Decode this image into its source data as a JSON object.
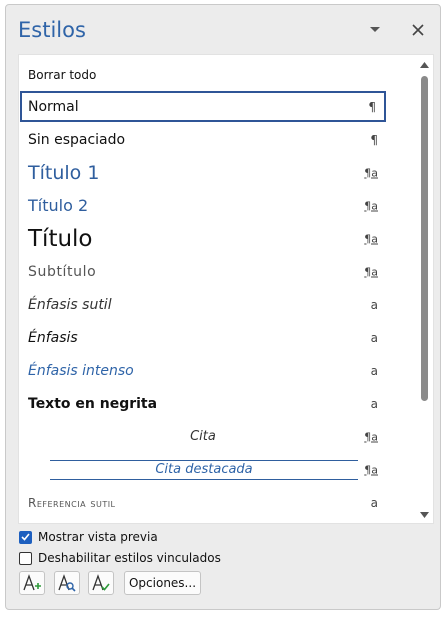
{
  "pane": {
    "title": "Estilos",
    "accent_color": "#2f64a8"
  },
  "styles": [
    {
      "label": "Borrar todo",
      "mark": "",
      "kind": "clear"
    },
    {
      "label": "Normal",
      "mark": "¶",
      "kind": "paragraph",
      "selected": true
    },
    {
      "label": "Sin espaciado",
      "mark": "¶",
      "kind": "paragraph"
    },
    {
      "label": "Título 1",
      "mark": "¶a",
      "kind": "linked"
    },
    {
      "label": "Título 2",
      "mark": "¶a",
      "kind": "linked"
    },
    {
      "label": "Título",
      "mark": "¶a",
      "kind": "linked"
    },
    {
      "label": "Subtítulo",
      "mark": "¶a",
      "kind": "linked"
    },
    {
      "label": "Énfasis sutil",
      "mark": "a",
      "kind": "character"
    },
    {
      "label": "Énfasis",
      "mark": "a",
      "kind": "character"
    },
    {
      "label": "Énfasis intenso",
      "mark": "a",
      "kind": "character"
    },
    {
      "label": "Texto en negrita",
      "mark": "a",
      "kind": "character"
    },
    {
      "label": "Cita",
      "mark": "¶a",
      "kind": "linked"
    },
    {
      "label": "Cita destacada",
      "mark": "¶a",
      "kind": "linked"
    },
    {
      "label": "Referencia sutil",
      "mark": "a",
      "kind": "character"
    }
  ],
  "options": {
    "show_preview": {
      "label": "Mostrar vista previa",
      "checked": true
    },
    "disable_linked": {
      "label": "Deshabilitar estilos vinculados",
      "checked": false
    }
  },
  "toolbar": {
    "new_style_icon": "new-style-icon",
    "style_inspector_icon": "style-inspector-icon",
    "manage_styles_icon": "manage-styles-icon",
    "options_label": "Opciones..."
  }
}
